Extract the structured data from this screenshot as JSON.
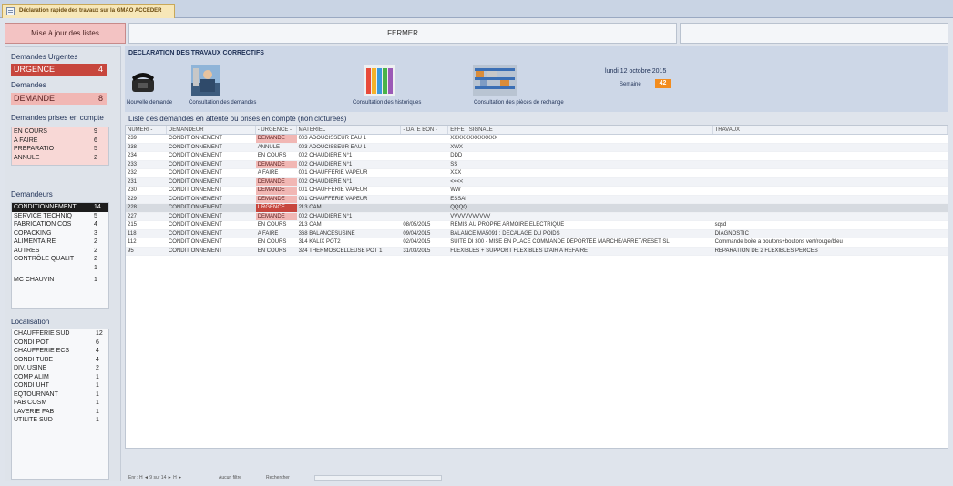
{
  "window": {
    "tab_title": "Déclaration rapide des travaux sur la GMAO ACCEDER"
  },
  "toolbar": {
    "update_label": "Mise à jour des listes",
    "close_label": "FERMER"
  },
  "left": {
    "urgent_title": "Demandes Urgentes",
    "urgent": {
      "label": "URGENCE",
      "count": "4"
    },
    "demandes_title": "Demandes",
    "demandes": {
      "label": "DEMANDE",
      "count": "8"
    },
    "taken_title": "Demandes prises en compte",
    "taken": [
      {
        "label": "EN COURS",
        "count": "9"
      },
      {
        "label": "A FAIRE",
        "count": "6"
      },
      {
        "label": "PREPARATIO",
        "count": "5"
      },
      {
        "label": "ANNULE",
        "count": "2"
      }
    ],
    "requesters_title": "Demandeurs",
    "requesters": [
      {
        "label": "CONDITIONNEMENT",
        "count": "14"
      },
      {
        "label": "SERVICE TECHNIQ",
        "count": "5"
      },
      {
        "label": "FABRICATION COS",
        "count": "4"
      },
      {
        "label": "COPACKING",
        "count": "3"
      },
      {
        "label": "ALIMENTAIRE",
        "count": "2"
      },
      {
        "label": "AUTRES",
        "count": "2"
      },
      {
        "label": "CONTRÔLE QUALIT",
        "count": "2"
      },
      {
        "label": "",
        "count": "1"
      },
      {
        "label": "MC CHAUVIN",
        "count": "1"
      }
    ],
    "location_title": "Localisation",
    "locations": [
      {
        "label": "CHAUFFERIE SUD",
        "count": "12"
      },
      {
        "label": "CONDI POT",
        "count": "6"
      },
      {
        "label": "CHAUFFERIE ECS",
        "count": "4"
      },
      {
        "label": "CONDI TUBE",
        "count": "4"
      },
      {
        "label": "DIV. USINE",
        "count": "2"
      },
      {
        "label": "COMP ALIM",
        "count": "1"
      },
      {
        "label": "CONDI UHT",
        "count": "1"
      },
      {
        "label": "EQTOURNANT",
        "count": "1"
      },
      {
        "label": "FAB COSM",
        "count": "1"
      },
      {
        "label": "LAVERIE FAB",
        "count": "1"
      },
      {
        "label": "UTILITE SUD",
        "count": "1"
      }
    ]
  },
  "header": {
    "title": "DECLARATION DES TRAVAUX CORRECTIFS",
    "actions": [
      {
        "label": "Nouvelle demande",
        "icon": "phone-icon"
      },
      {
        "label": "Consultation des demandes",
        "icon": "technician-icon"
      },
      {
        "label": "Consultation des historiques",
        "icon": "binders-icon"
      },
      {
        "label": "Consultation des pièces de rechange",
        "icon": "warehouse-icon"
      }
    ],
    "date": "lundi 12 octobre 2015",
    "week_label": "Semaine",
    "week": "42"
  },
  "list": {
    "title": "Liste des demandes en attente ou prises en compte (non clôturées)",
    "columns": [
      "NUMERI -",
      "DEMANDEUR",
      "- URGENCE -",
      "MATERIEL",
      "- DATE BON -",
      "EFFET SIGNALE",
      "TRAVAUX"
    ],
    "rows": [
      [
        "239",
        "CONDITIONNEMENT",
        "DEMANDE",
        "003 ADOUCISSEUR EAU 1",
        "",
        "XXXXXXXXXXXXX",
        ""
      ],
      [
        "238",
        "CONDITIONNEMENT",
        "ANNULE",
        "003 ADOUCISSEUR EAU 1",
        "",
        "XWX",
        ""
      ],
      [
        "234",
        "CONDITIONNEMENT",
        "EN COURS",
        "002 CHAUDIERE N°1",
        "",
        "DDD",
        ""
      ],
      [
        "233",
        "CONDITIONNEMENT",
        "DEMANDE",
        "002 CHAUDIERE N°1",
        "",
        "SS",
        ""
      ],
      [
        "232",
        "CONDITIONNEMENT",
        "A FAIRE",
        "001 CHAUFFERIE VAPEUR",
        "",
        "XXX",
        ""
      ],
      [
        "231",
        "CONDITIONNEMENT",
        "DEMANDE",
        "002 CHAUDIERE N°1",
        "",
        "<<<<",
        ""
      ],
      [
        "230",
        "CONDITIONNEMENT",
        "DEMANDE",
        "001 CHAUFFERIE VAPEUR",
        "",
        "WW",
        ""
      ],
      [
        "229",
        "CONDITIONNEMENT",
        "DEMANDE",
        "001 CHAUFFERIE VAPEUR",
        "",
        "ESSAI",
        ""
      ],
      [
        "228",
        "CONDITIONNEMENT",
        "URGENCE",
        "213 CAM",
        "",
        "QQQQ",
        ""
      ],
      [
        "227",
        "CONDITIONNEMENT",
        "DEMANDE",
        "002 CHAUDIERE N°1",
        "",
        "VVVVVVVVVVV",
        ""
      ],
      [
        "215",
        "CONDITIONNEMENT",
        "EN COURS",
        "213 CAM",
        "08/05/2015",
        "REMIS AU PROPRE ARMOIRE ELECTRIQUE",
        "sqsd"
      ],
      [
        "118",
        "CONDITIONNEMENT",
        "A FAIRE",
        "368 BALANCESUSINE",
        "09/04/2015",
        "BALANCE MA5091 : DECALAGE DU POIDS",
        "DIAGNOSTIC"
      ],
      [
        "112",
        "CONDITIONNEMENT",
        "EN COURS",
        "314 KALIX POT2",
        "02/04/2015",
        "SUITE DI 300 - MISE EN PLACE COMMANDE DÉPORTÉE MARCHE/ARRET/RESET SL",
        "Commande boite a boutons+boutons vert/rouge/bleu"
      ],
      [
        "95",
        "CONDITIONNEMENT",
        "EN COURS",
        "324 THERMOSCELLEUSE POT 1",
        "31/03/2015",
        "FLEXIBLES + SUPPORT FLEXIBLES D'AIR A REFAIRE",
        "REPARATION DE 2 FLEXIBLES PERCES"
      ]
    ]
  },
  "navigation": {
    "record": "Enr : H  ◄ 9 sur 14  ► H ►",
    "filter": "Aucun filtre",
    "search": "Rechercher"
  }
}
